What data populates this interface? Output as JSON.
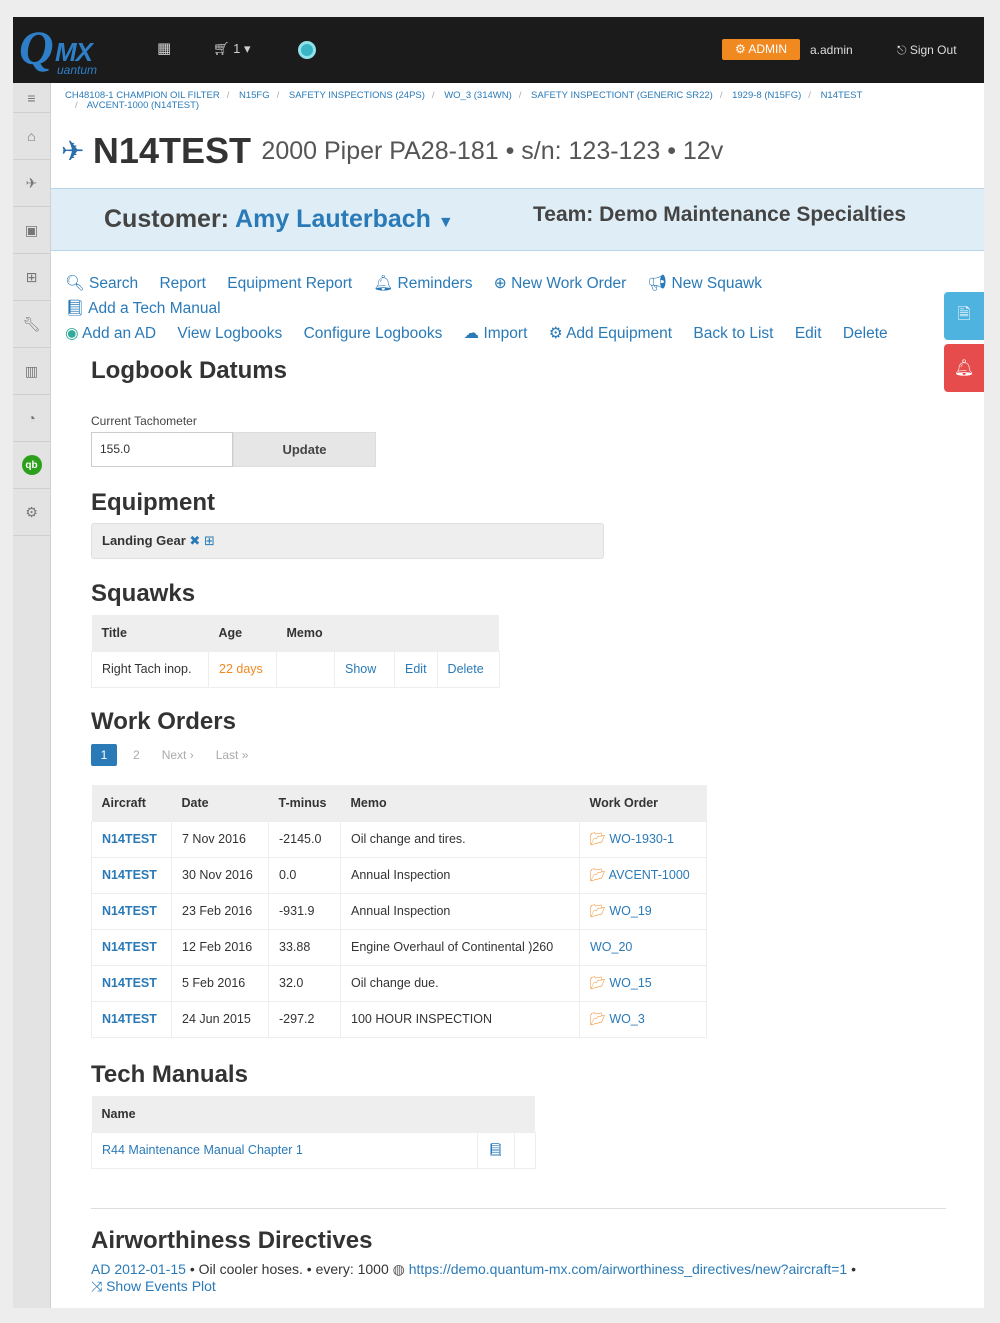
{
  "topbar": {
    "logo_q": "Q",
    "logo_mx": "MX",
    "logo_tag": "uantum",
    "cart_count": "1",
    "admin_label": "ADMIN",
    "user": "a.admin",
    "signout": "Sign Out"
  },
  "breadcrumb": [
    "CH48108-1 CHAMPION OIL FILTER",
    "N15FG",
    "SAFETY INSPECTIONS (24PS)",
    "WO_3 (314WN)",
    "SAFETY INSPECTIONT (GENERIC SR22)",
    "1929-8 (N15FG)",
    "N14TEST",
    "AVCENT-1000 (N14TEST)"
  ],
  "aircraft": {
    "tail": "N14TEST",
    "model": "2000 Piper PA28-181 • s/n: 123-123 • 12v"
  },
  "customer": {
    "label": "Customer:",
    "name": "Amy Lauterbach",
    "team": "Team: Demo Maintenance Specialties"
  },
  "actions": [
    "Search",
    "Report",
    "Equipment Report",
    "Reminders",
    "New Work Order",
    "New Squawk",
    "Add a Tech Manual",
    "Add an AD",
    "View Logbooks",
    "Configure Logbooks",
    "Import",
    "Add Equipment",
    "Back to List",
    "Edit",
    "Delete"
  ],
  "logbook": {
    "heading": "Logbook Datums",
    "tach_label": "Current Tachometer",
    "tach_value": "155.0",
    "update": "Update"
  },
  "equipment": {
    "heading": "Equipment",
    "item": "Landing Gear"
  },
  "squawks": {
    "heading": "Squawks",
    "cols": [
      "Title",
      "Age",
      "Memo"
    ],
    "row": {
      "title": "Right Tach inop.",
      "age": "22 days",
      "memo": "",
      "show": "Show",
      "edit": "Edit",
      "delete": "Delete"
    }
  },
  "work_orders": {
    "heading": "Work Orders",
    "pager": {
      "current": "1",
      "next_page": "2",
      "next": "Next ›",
      "last": "Last »"
    },
    "cols": [
      "Aircraft",
      "Date",
      "T-minus",
      "Memo",
      "Work Order"
    ],
    "rows": [
      {
        "aircraft": "N14TEST",
        "date": "7 Nov 2016",
        "tminus": "-2145.0",
        "memo": "Oil change and tires.",
        "wo": "WO-1930-1"
      },
      {
        "aircraft": "N14TEST",
        "date": "30 Nov 2016",
        "tminus": "0.0",
        "memo": "Annual Inspection",
        "wo": "AVCENT-1000"
      },
      {
        "aircraft": "N14TEST",
        "date": "23 Feb 2016",
        "tminus": "-931.9",
        "memo": "Annual Inspection",
        "wo": "WO_19"
      },
      {
        "aircraft": "N14TEST",
        "date": "12 Feb 2016",
        "tminus": "33.88",
        "memo": "Engine Overhaul of Continental )260",
        "wo": "WO_20"
      },
      {
        "aircraft": "N14TEST",
        "date": "5 Feb 2016",
        "tminus": "32.0",
        "memo": "Oil change due.",
        "wo": "WO_15"
      },
      {
        "aircraft": "N14TEST",
        "date": "24 Jun 2015",
        "tminus": "-297.2",
        "memo": "100 HOUR INSPECTION",
        "wo": "WO_3"
      }
    ]
  },
  "tech_manuals": {
    "heading": "Tech Manuals",
    "col": "Name",
    "item": "R44 Maintenance Manual Chapter 1"
  },
  "ads": {
    "heading": "Airworthiness Directives",
    "ad": "AD 2012-01-15",
    "text": "• Oil cooler hoses. • every: 1000",
    "url": "https://demo.quantum-mx.com/airworthiness_directives/new?aircraft=1",
    "plot": "Show Events Plot"
  },
  "colors": {
    "accent": "#2a7ab8",
    "admin": "#f0891f",
    "danger": "#e74c4c",
    "info": "#4fb3e0"
  }
}
